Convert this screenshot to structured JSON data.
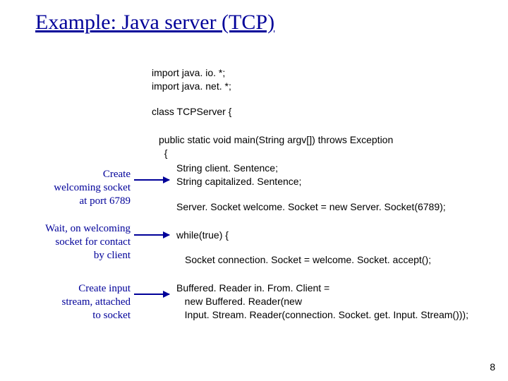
{
  "title": "Example: Java server (TCP)",
  "code": {
    "imports": "import java. io. *;\nimport java. net. *;",
    "classDecl": "class TCPServer {",
    "mainSig": "public static void main(String argv[]) throws Exception\n  {",
    "decls": "String client. Sentence;\nString capitalized. Sentence;",
    "welcome": "Server. Socket welcome. Socket = new Server. Socket(6789);",
    "loop": "while(true) {",
    "accept": "Socket connection. Socket = welcome. Socket. accept();",
    "reader": "Buffered. Reader in. From. Client =\n   new Buffered. Reader(new\n   Input. Stream. Reader(connection. Socket. get. Input. Stream()));"
  },
  "annotations": {
    "a1": "Create\nwelcoming socket\nat port 6789",
    "a2": "Wait, on welcoming\nsocket for contact\nby client",
    "a3": "Create input\nstream, attached\nto socket"
  },
  "pageNumber": "8"
}
